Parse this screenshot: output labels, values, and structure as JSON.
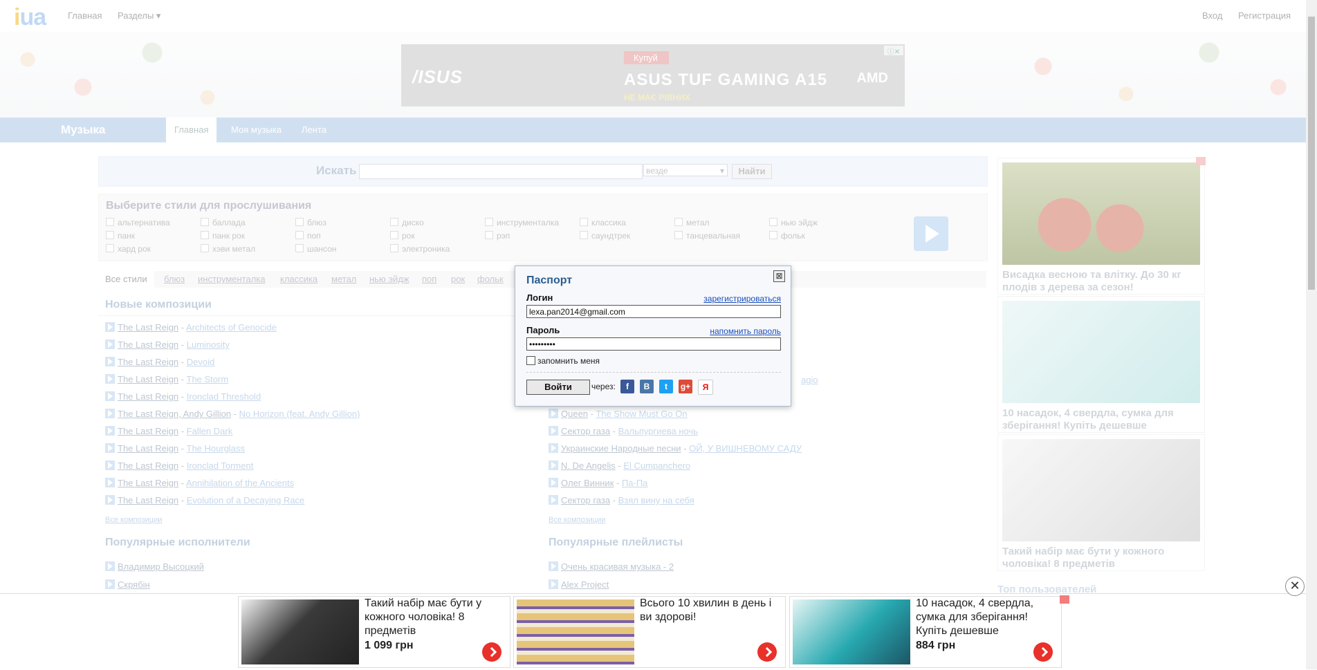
{
  "topbar": {
    "logo": "ua",
    "nav": [
      "Главная",
      "Разделы ▾"
    ],
    "login": "Вход",
    "register": "Регистрация"
  },
  "banner_ad": {
    "brand": "/ISUS",
    "buy": "Купуй",
    "model": "ASUS TUF GAMING A15",
    "subtitle": "НЕ МАЄ РІВНИХ",
    "partner": "AMD"
  },
  "musicbar": {
    "title": "Музыка",
    "tabs": [
      "Главная",
      "Моя музыка",
      "Лента"
    ]
  },
  "search": {
    "label": "Искать",
    "value": "",
    "scope": "везде",
    "button": "Найти"
  },
  "styles": {
    "heading": "Выберите стили для прослушивания",
    "items": [
      "альтернатива",
      "баллада",
      "блюз",
      "диско",
      "инструменталка",
      "классика",
      "метал",
      "нью эйдж",
      "панк",
      "панк рок",
      "поп",
      "рок",
      "рэп",
      "саундтрек",
      "танцевальная",
      "фольк",
      "хард рок",
      "хэви метал",
      "шансон",
      "электроника"
    ]
  },
  "genre_tabs": [
    "Все стили",
    "блюз",
    "инструменталка",
    "классика",
    "метал",
    "нью эйдж",
    "поп",
    "рок",
    "фольк"
  ],
  "new_tracks": {
    "heading": "Новые композиции",
    "left": [
      {
        "artist": "The Last Reign",
        "song": "Architects of Genocide"
      },
      {
        "artist": "The Last Reign",
        "song": "Luminosity"
      },
      {
        "artist": "The Last Reign",
        "song": "Devoid"
      },
      {
        "artist": "The Last Reign",
        "song": "The Storm"
      },
      {
        "artist": "The Last Reign",
        "song": "Ironclad Threshold"
      },
      {
        "artist": "The Last Reign, Andy Gillion",
        "song": "No Horizon (feat. Andy Gillion)"
      },
      {
        "artist": "The Last Reign",
        "song": "Fallen Dark"
      },
      {
        "artist": "The Last Reign",
        "song": "The Hourglass"
      },
      {
        "artist": "The Last Reign",
        "song": "Ironclad Torment"
      },
      {
        "artist": "The Last Reign",
        "song": "Annihilation of the Ancients"
      },
      {
        "artist": "The Last Reign",
        "song": "Evolution of a Decaying Race"
      }
    ],
    "right_partial": "agio",
    "right": [
      {
        "artist": "Queen",
        "song": "The Show Must Go On"
      },
      {
        "artist": "Сектор газа",
        "song": "Вальпургиева ночь"
      },
      {
        "artist": "Украинские Народные песни",
        "song": "ОЙ, У ВИШНЕВОМУ САДУ"
      },
      {
        "artist": "N. De Angelis",
        "song": "El Cumpanchero"
      },
      {
        "artist": "Олег Винник",
        "song": "Па-Па"
      },
      {
        "artist": "Сектор газа",
        "song": "Взял вину на себя"
      }
    ],
    "all_link": "Все композиции"
  },
  "popular_artists": {
    "heading": "Популярные исполнители",
    "items": [
      "Владимир Высоцкий",
      "Скрябін"
    ]
  },
  "popular_playlists": {
    "heading": "Популярные плейлисты",
    "items": [
      "Очень красивая музыка - 2",
      "Alex Project"
    ]
  },
  "right_ads": [
    {
      "text": "Висадка весною та влітку. До 30 кг плодів з дерева за сезон!"
    },
    {
      "text": "10 насадок, 4 свердла, сумка для зберігання! Купіть дешевше"
    },
    {
      "text": "Такий набір має бути у кожного чоловіка! 8 предметів"
    }
  ],
  "right_footer_partial": "Топ пользователей",
  "bottom_ads": [
    {
      "text": "Такий набір має бути у кожного чоловіка! 8 предметів",
      "price": "1 099 грн"
    },
    {
      "text": "Всього 10 хвилин в день і ви здорові!",
      "price": ""
    },
    {
      "text": "10 насадок, 4 свердла, сумка для зберігання! Купіть дешевше",
      "price": "884 грн"
    }
  ],
  "bottom_close": "✕",
  "passport": {
    "title": "Паспорт",
    "close": "⊠",
    "login_label": "Логин",
    "register_link": "зарегистрироваться",
    "login_value": "lexa.pan2014@gmail.com",
    "password_label": "Пароль",
    "remind_link": "напомнить пароль",
    "password_value": "•••••••••",
    "remember": "запомнить меня",
    "submit": "Войти",
    "via": "через:",
    "social": [
      {
        "name": "facebook-icon",
        "glyph": "f",
        "color": "#3b5998"
      },
      {
        "name": "vkontakte-icon",
        "glyph": "B",
        "color": "#4a76a8"
      },
      {
        "name": "twitter-icon",
        "glyph": "t",
        "color": "#1da1f2"
      },
      {
        "name": "google-plus-icon",
        "glyph": "g+",
        "color": "#dd4b39"
      },
      {
        "name": "yandex-icon",
        "glyph": "Я",
        "color": "#fff"
      }
    ]
  }
}
